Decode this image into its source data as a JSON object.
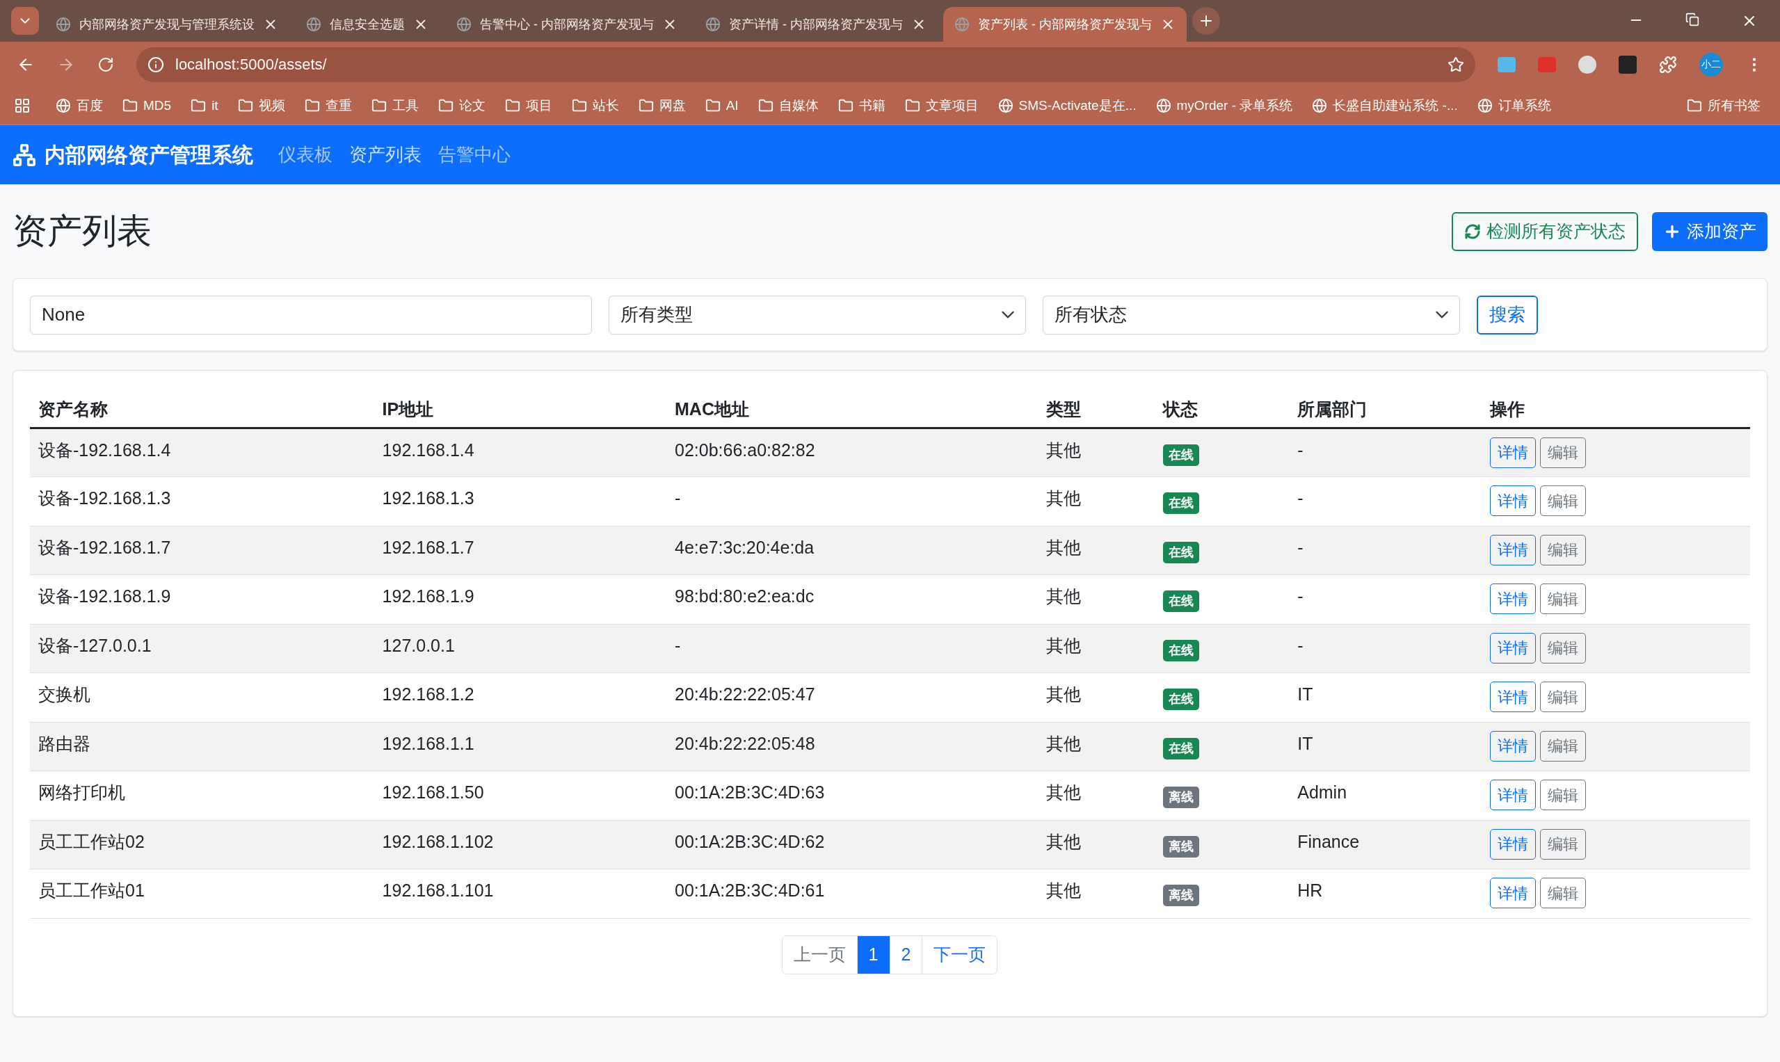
{
  "browser": {
    "tabs": [
      {
        "title": "内部网络资产发现与管理系统设",
        "selected": false
      },
      {
        "title": "信息安全选题",
        "selected": false
      },
      {
        "title": "告警中心 - 内部网络资产发现与",
        "selected": false
      },
      {
        "title": "资产详情 - 内部网络资产发现与",
        "selected": false
      },
      {
        "title": "资产列表 - 内部网络资产发现与",
        "selected": true
      }
    ],
    "url": "localhost:5000/assets/",
    "profile": "小二",
    "bookmarks": [
      {
        "label": "百度",
        "kind": "site"
      },
      {
        "label": "MD5",
        "kind": "folder"
      },
      {
        "label": "it",
        "kind": "folder"
      },
      {
        "label": "视频",
        "kind": "folder"
      },
      {
        "label": "查重",
        "kind": "folder"
      },
      {
        "label": "工具",
        "kind": "folder"
      },
      {
        "label": "论文",
        "kind": "folder"
      },
      {
        "label": "项目",
        "kind": "folder"
      },
      {
        "label": "站长",
        "kind": "folder"
      },
      {
        "label": "网盘",
        "kind": "folder"
      },
      {
        "label": "AI",
        "kind": "folder"
      },
      {
        "label": "自媒体",
        "kind": "folder"
      },
      {
        "label": "书籍",
        "kind": "folder"
      },
      {
        "label": "文章项目",
        "kind": "folder"
      },
      {
        "label": "SMS-Activate是在...",
        "kind": "site"
      },
      {
        "label": "myOrder - 录单系统",
        "kind": "site"
      },
      {
        "label": "长盛自助建站系统 -...",
        "kind": "site"
      },
      {
        "label": "订单系统",
        "kind": "site"
      }
    ],
    "all_bookmarks": "所有书签"
  },
  "navbar": {
    "brand": "内部网络资产管理系统",
    "links": [
      {
        "label": "仪表板",
        "selected": false
      },
      {
        "label": "资产列表",
        "selected": true
      },
      {
        "label": "告警中心",
        "selected": false
      }
    ]
  },
  "page": {
    "title": "资产列表",
    "check_button": "检测所有资产状态",
    "add_button": "添加资产"
  },
  "filters": {
    "search_value": "None",
    "type_select": "所有类型",
    "status_select": "所有状态",
    "search_button": "搜索"
  },
  "table": {
    "columns": [
      "资产名称",
      "IP地址",
      "MAC地址",
      "类型",
      "状态",
      "所属部门",
      "操作"
    ],
    "rows": [
      {
        "name": "设备-192.168.1.4",
        "ip": "192.168.1.4",
        "mac": "02:0b:66:a0:82:82",
        "type": "其他",
        "status": "在线",
        "online": true,
        "dept": "-"
      },
      {
        "name": "设备-192.168.1.3",
        "ip": "192.168.1.3",
        "mac": "-",
        "type": "其他",
        "status": "在线",
        "online": true,
        "dept": "-"
      },
      {
        "name": "设备-192.168.1.7",
        "ip": "192.168.1.7",
        "mac": "4e:e7:3c:20:4e:da",
        "type": "其他",
        "status": "在线",
        "online": true,
        "dept": "-"
      },
      {
        "name": "设备-192.168.1.9",
        "ip": "192.168.1.9",
        "mac": "98:bd:80:e2:ea:dc",
        "type": "其他",
        "status": "在线",
        "online": true,
        "dept": "-"
      },
      {
        "name": "设备-127.0.0.1",
        "ip": "127.0.0.1",
        "mac": "-",
        "type": "其他",
        "status": "在线",
        "online": true,
        "dept": "-"
      },
      {
        "name": "交换机",
        "ip": "192.168.1.2",
        "mac": "20:4b:22:22:05:47",
        "type": "其他",
        "status": "在线",
        "online": true,
        "dept": "IT"
      },
      {
        "name": "路由器",
        "ip": "192.168.1.1",
        "mac": "20:4b:22:22:05:48",
        "type": "其他",
        "status": "在线",
        "online": true,
        "dept": "IT"
      },
      {
        "name": "网络打印机",
        "ip": "192.168.1.50",
        "mac": "00:1A:2B:3C:4D:63",
        "type": "其他",
        "status": "离线",
        "online": false,
        "dept": "Admin"
      },
      {
        "name": "员工工作站02",
        "ip": "192.168.1.102",
        "mac": "00:1A:2B:3C:4D:62",
        "type": "其他",
        "status": "离线",
        "online": false,
        "dept": "Finance"
      },
      {
        "name": "员工工作站01",
        "ip": "192.168.1.101",
        "mac": "00:1A:2B:3C:4D:61",
        "type": "其他",
        "status": "离线",
        "online": false,
        "dept": "HR"
      }
    ],
    "actions": [
      [
        "详情",
        "编辑"
      ],
      [
        "详情",
        "编辑"
      ],
      [
        "详情",
        "编辑"
      ],
      [
        "详情",
        "编辑"
      ],
      [
        "详情",
        "编辑"
      ],
      [
        "详情",
        "编辑"
      ],
      [
        "详情",
        "编辑"
      ],
      [
        "详情",
        "编辑"
      ],
      [
        "详情",
        "编辑"
      ],
      [
        "详情",
        "编辑"
      ]
    ]
  },
  "pagination": [
    {
      "label": "上一页",
      "selected": false,
      "disabled": true
    },
    {
      "label": "1",
      "selected": true,
      "disabled": false
    },
    {
      "label": "2",
      "selected": false,
      "disabled": false
    },
    {
      "label": "下一页",
      "selected": false,
      "disabled": false
    }
  ]
}
